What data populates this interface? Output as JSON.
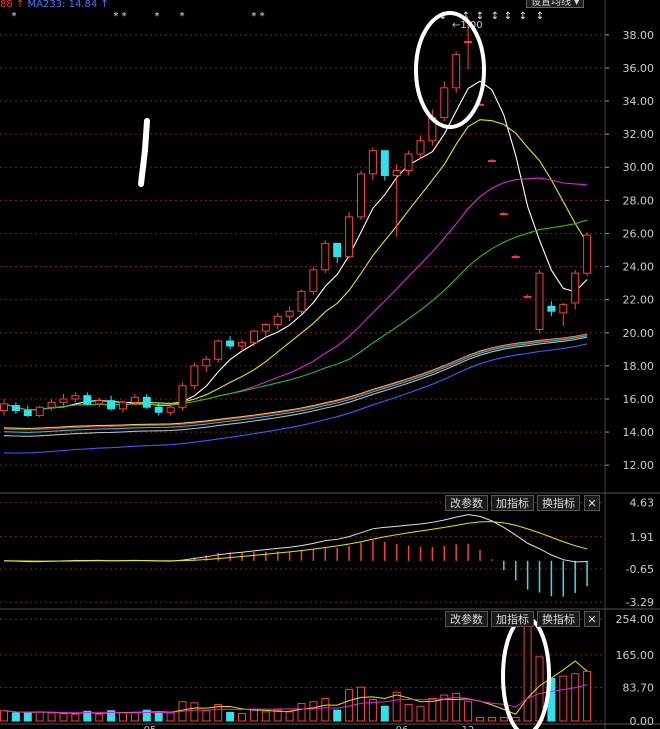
{
  "header": {
    "ma_prefix": "88 ↑",
    "ma_label": "MA233: 14.84 ↑",
    "settings_button": "设置均线 ▾"
  },
  "event_markers": [
    "*",
    "* *",
    "*",
    "*",
    "* *",
    "↕",
    "↕",
    "↕",
    "↕",
    "↕",
    "↕",
    "↕"
  ],
  "peak_label": "←1.00",
  "price_axis": {
    "ticks": [
      "38.00",
      "36.00",
      "34.00",
      "32.00",
      "30.00",
      "28.00",
      "26.00",
      "24.00",
      "22.00",
      "20.00",
      "18.00",
      "16.00",
      "14.00",
      "12.00"
    ]
  },
  "macd_panel": {
    "ticks": [
      "4.63",
      "1.91",
      "-0.65",
      "-3.29"
    ],
    "buttons": [
      "改参数",
      "加指标",
      "换指标"
    ]
  },
  "volume_panel": {
    "ticks": [
      "254.00",
      "165.00",
      "83.70",
      "0.00"
    ],
    "buttons": [
      "改参数",
      "加指标",
      "换指标"
    ]
  },
  "x_axis": {
    "labels": [
      "05",
      "06",
      "12"
    ]
  },
  "chart_data": {
    "type": "candlestick",
    "price_ylim": [
      10.5,
      39.5
    ],
    "candles": [
      [
        15.3,
        16.0,
        15.0,
        15.7
      ],
      [
        15.6,
        15.8,
        15.1,
        15.3
      ],
      [
        15.3,
        15.6,
        14.9,
        15.0
      ],
      [
        15.0,
        15.6,
        14.9,
        15.5
      ],
      [
        15.5,
        16.0,
        15.3,
        15.8
      ],
      [
        15.8,
        16.3,
        15.6,
        16.0
      ],
      [
        16.0,
        16.4,
        15.8,
        16.2
      ],
      [
        16.2,
        16.4,
        15.6,
        15.7
      ],
      [
        15.7,
        16.1,
        15.5,
        15.9
      ],
      [
        15.9,
        16.2,
        15.3,
        15.4
      ],
      [
        15.4,
        15.9,
        15.2,
        15.8
      ],
      [
        15.8,
        16.3,
        15.6,
        16.1
      ],
      [
        16.1,
        16.3,
        15.4,
        15.5
      ],
      [
        15.5,
        15.8,
        15.0,
        15.2
      ],
      [
        15.2,
        15.7,
        15.0,
        15.5
      ],
      [
        15.5,
        17.0,
        15.3,
        16.8
      ],
      [
        16.8,
        18.2,
        16.6,
        18.0
      ],
      [
        18.0,
        18.6,
        17.6,
        18.4
      ],
      [
        18.4,
        19.6,
        18.2,
        19.5
      ],
      [
        19.5,
        19.8,
        19.0,
        19.2
      ],
      [
        19.2,
        19.6,
        18.9,
        19.4
      ],
      [
        19.4,
        20.2,
        19.2,
        20.1
      ],
      [
        20.1,
        20.6,
        19.8,
        20.5
      ],
      [
        20.5,
        21.2,
        20.2,
        21.0
      ],
      [
        21.0,
        21.6,
        20.7,
        21.3
      ],
      [
        21.3,
        22.6,
        21.1,
        22.5
      ],
      [
        22.5,
        24.0,
        22.3,
        23.8
      ],
      [
        23.8,
        25.6,
        23.6,
        25.4
      ],
      [
        25.4,
        24.9,
        24.2,
        24.6
      ],
      [
        24.6,
        27.3,
        24.5,
        27.0
      ],
      [
        27.0,
        29.8,
        26.8,
        29.6
      ],
      [
        29.6,
        31.2,
        29.2,
        31.0
      ],
      [
        31.0,
        29.9,
        29.2,
        29.5
      ],
      [
        29.5,
        30.2,
        25.8,
        29.8
      ],
      [
        29.8,
        31.0,
        29.5,
        30.8
      ],
      [
        30.8,
        31.9,
        30.5,
        31.6
      ],
      [
        31.6,
        33.5,
        31.3,
        33.0
      ],
      [
        33.0,
        35.2,
        32.8,
        34.8
      ],
      [
        34.8,
        37.0,
        34.5,
        36.8
      ],
      [
        37.6,
        39.0,
        35.9,
        37.6
      ],
      [
        33.8,
        33.9,
        33.7,
        33.8
      ],
      [
        30.4,
        30.5,
        30.3,
        30.4
      ],
      [
        27.2,
        27.3,
        27.1,
        27.2
      ],
      [
        24.6,
        24.7,
        24.5,
        24.6
      ],
      [
        22.2,
        22.3,
        22.1,
        22.2
      ],
      [
        20.2,
        23.8,
        20.0,
        23.6
      ],
      [
        21.6,
        21.9,
        21.0,
        21.3
      ],
      [
        21.2,
        21.8,
        20.4,
        21.7
      ],
      [
        21.8,
        23.8,
        21.4,
        23.6
      ],
      [
        23.6,
        26.1,
        23.4,
        25.9
      ]
    ],
    "macd": {
      "ylim": [
        -3.6,
        5.0
      ]
    },
    "volume": {
      "ylim": [
        0,
        262
      ]
    }
  }
}
